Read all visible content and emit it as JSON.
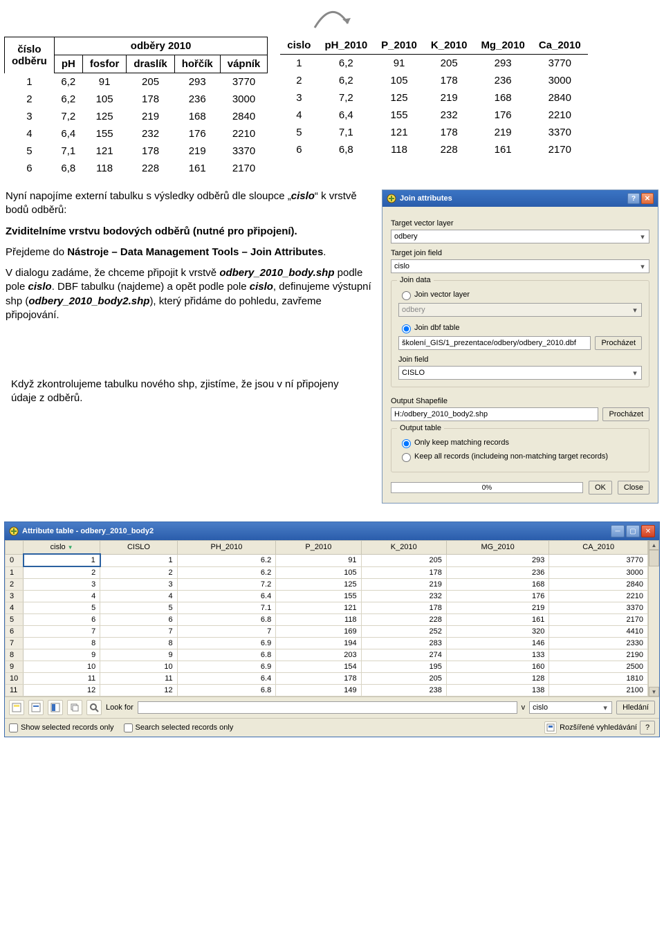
{
  "arrow": "↷",
  "table1": {
    "corner": "číslo\nodběru",
    "group_title": "odběry 2010",
    "cols": [
      "pH",
      "fosfor",
      "draslík",
      "hořčík",
      "vápník"
    ],
    "rows": [
      {
        "n": "1",
        "c": [
          "6,2",
          "91",
          "205",
          "293",
          "3770"
        ]
      },
      {
        "n": "2",
        "c": [
          "6,2",
          "105",
          "178",
          "236",
          "3000"
        ]
      },
      {
        "n": "3",
        "c": [
          "7,2",
          "125",
          "219",
          "168",
          "2840"
        ]
      },
      {
        "n": "4",
        "c": [
          "6,4",
          "155",
          "232",
          "176",
          "2210"
        ]
      },
      {
        "n": "5",
        "c": [
          "7,1",
          "121",
          "178",
          "219",
          "3370"
        ]
      },
      {
        "n": "6",
        "c": [
          "6,8",
          "118",
          "228",
          "161",
          "2170"
        ]
      }
    ]
  },
  "table2": {
    "cols": [
      "cislo",
      "pH_2010",
      "P_2010",
      "K_2010",
      "Mg_2010",
      "Ca_2010"
    ],
    "rows": [
      {
        "c": [
          "1",
          "6,2",
          "91",
          "205",
          "293",
          "3770"
        ]
      },
      {
        "c": [
          "2",
          "6,2",
          "105",
          "178",
          "236",
          "3000"
        ]
      },
      {
        "c": [
          "3",
          "7,2",
          "125",
          "219",
          "168",
          "2840"
        ]
      },
      {
        "c": [
          "4",
          "6,4",
          "155",
          "232",
          "176",
          "2210"
        ]
      },
      {
        "c": [
          "5",
          "7,1",
          "121",
          "178",
          "219",
          "3370"
        ]
      },
      {
        "c": [
          "6",
          "6,8",
          "118",
          "228",
          "161",
          "2170"
        ]
      }
    ]
  },
  "txt": {
    "p1a": "Nyní napojíme externí tabulku s výsledky odběrů dle sloupce „",
    "p1_cislo": "cislo",
    "p1b": "“ k vrstvě bodů odběrů:",
    "p2": "Zviditelníme vrstvu bodových odběrů (nutné pro připojení).",
    "p3a": "Přejdeme do ",
    "p3b": "Nástroje – Data Management Tools – Join Attributes",
    "p3c": ".",
    "p4a": "V dialogu zadáme, že chceme připojit k vrstvě ",
    "p4b": "odbery_2010_body.shp",
    "p4c": " podle pole ",
    "p4d": "cislo",
    "p4e": ". DBF tabulku (najdeme) a opět podle pole ",
    "p4f": "cislo",
    "p4g": ", definujeme výstupní shp (",
    "p4h": "odbery_2010_body2.shp",
    "p4i": "), který přidáme do pohledu, zavřeme připojování.",
    "p5": "Když zkontrolujeme tabulku nového shp, zjistíme, že jsou v ní připojeny údaje z odběrů."
  },
  "dlg": {
    "title": "Join attributes",
    "lbl_target_layer": "Target vector layer",
    "val_target_layer": "odbery",
    "lbl_target_field": "Target join field",
    "val_target_field": "cislo",
    "grp_join_data": "Join data",
    "rad_join_vector": "Join vector layer",
    "val_join_vector": "odbery",
    "rad_join_dbf": "Join dbf table",
    "val_join_dbf": "školení_GIS/1_prezentace/odbery/odbery_2010.dbf",
    "btn_browse": "Procházet",
    "lbl_join_field": "Join field",
    "val_join_field": "CISLO",
    "lbl_output_shp": "Output Shapefile",
    "val_output_shp": "H:/odbery_2010_body2.shp",
    "grp_output_table": "Output table",
    "rad_only_match": "Only keep matching records",
    "rad_keep_all": "Keep all records (includeing non-matching target records)",
    "progress": "0%",
    "btn_ok": "OK",
    "btn_close": "Close"
  },
  "attr": {
    "title": "Attribute table - odbery_2010_body2",
    "cols": [
      "cislo",
      "CISLO",
      "PH_2010",
      "P_2010",
      "K_2010",
      "MG_2010",
      "CA_2010"
    ],
    "rows": [
      {
        "h": "0",
        "c": [
          "1",
          "1",
          "6.2",
          "91",
          "205",
          "293",
          "3770"
        ]
      },
      {
        "h": "1",
        "c": [
          "2",
          "2",
          "6.2",
          "105",
          "178",
          "236",
          "3000"
        ]
      },
      {
        "h": "2",
        "c": [
          "3",
          "3",
          "7.2",
          "125",
          "219",
          "168",
          "2840"
        ]
      },
      {
        "h": "3",
        "c": [
          "4",
          "4",
          "6.4",
          "155",
          "232",
          "176",
          "2210"
        ]
      },
      {
        "h": "4",
        "c": [
          "5",
          "5",
          "7.1",
          "121",
          "178",
          "219",
          "3370"
        ]
      },
      {
        "h": "5",
        "c": [
          "6",
          "6",
          "6.8",
          "118",
          "228",
          "161",
          "2170"
        ]
      },
      {
        "h": "6",
        "c": [
          "7",
          "7",
          "7",
          "169",
          "252",
          "320",
          "4410"
        ]
      },
      {
        "h": "7",
        "c": [
          "8",
          "8",
          "6.9",
          "194",
          "283",
          "146",
          "2330"
        ]
      },
      {
        "h": "8",
        "c": [
          "9",
          "9",
          "6.8",
          "203",
          "274",
          "133",
          "2190"
        ]
      },
      {
        "h": "9",
        "c": [
          "10",
          "10",
          "6.9",
          "154",
          "195",
          "160",
          "2500"
        ]
      },
      {
        "h": "10",
        "c": [
          "11",
          "11",
          "6.4",
          "178",
          "205",
          "128",
          "1810"
        ]
      },
      {
        "h": "11",
        "c": [
          "12",
          "12",
          "6.8",
          "149",
          "238",
          "138",
          "2100"
        ]
      }
    ],
    "toolbar": {
      "look_for": "Look for",
      "in": "v",
      "in_field": "cislo",
      "btn_search": "Hledání"
    },
    "status": {
      "show_selected": "Show selected records only",
      "search_selected": "Search selected records only",
      "adv_search": "Rozšířené vyhledávání",
      "help": "?"
    }
  }
}
